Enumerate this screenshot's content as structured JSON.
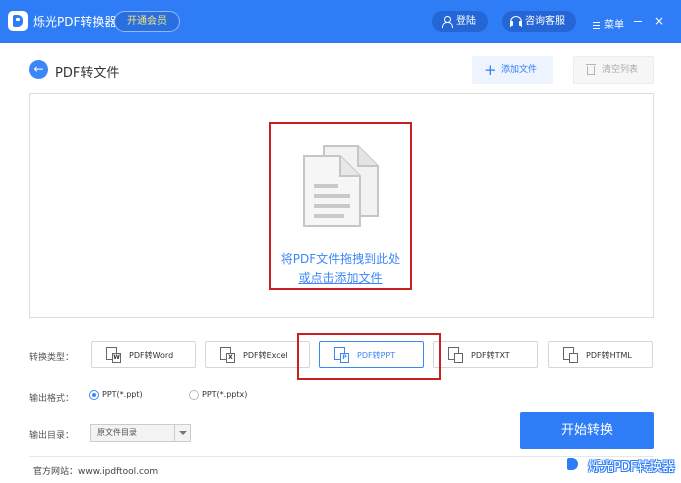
{
  "app": {
    "title": "烁光PDF转换器",
    "vip_label": "开通会员"
  },
  "titlebar": {
    "login_label": "登陆",
    "support_label": "咨询客服",
    "menu_label": "菜单",
    "close_glyph": "×"
  },
  "header": {
    "back_glyph": "←",
    "page_title": "PDF转文件",
    "add_file_label": "添加文件",
    "add_glyph": "+",
    "clear_label": "清空列表"
  },
  "dropzone": {
    "line1": "将PDF文件拖拽到此处",
    "line2": "或点击添加文件"
  },
  "conversion": {
    "label": "转换类型：",
    "selected": "PDF转PPT",
    "types": [
      {
        "label": "PDF转Word",
        "badge": "W",
        "icon": "word-file-icon"
      },
      {
        "label": "PDF转Excel",
        "badge": "X",
        "icon": "excel-file-icon"
      },
      {
        "label": "PDF转PPT",
        "badge": "P",
        "icon": "ppt-file-icon"
      },
      {
        "label": "PDF转TXT",
        "badge": "",
        "icon": "txt-file-icon"
      },
      {
        "label": "PDF转HTML",
        "badge": "",
        "icon": "html-file-icon"
      }
    ]
  },
  "output_format": {
    "label": "输出格式：",
    "selected": "PPT(*.ppt)",
    "options": [
      "PPT(*.ppt)",
      "PPT(*.pptx)"
    ]
  },
  "output_dir": {
    "label": "输出目录：",
    "value": "原文件目录"
  },
  "start_label": "开始转换",
  "footer": {
    "site": "官方网站：www.ipdftool.com",
    "watermark": "烁光PDF转换器"
  },
  "colors": {
    "brand": "#2f7df6",
    "highlight": "#c8201f",
    "link": "#3d86f7"
  },
  "icons": [
    "app-logo-icon",
    "user-icon",
    "headset-icon",
    "menu-icon",
    "minimize-icon",
    "close-icon",
    "back-arrow-icon",
    "plus-icon",
    "trash-icon",
    "documents-icon",
    "word-file-icon",
    "excel-file-icon",
    "ppt-file-icon",
    "txt-file-icon",
    "html-file-icon",
    "chevron-down-icon"
  ]
}
